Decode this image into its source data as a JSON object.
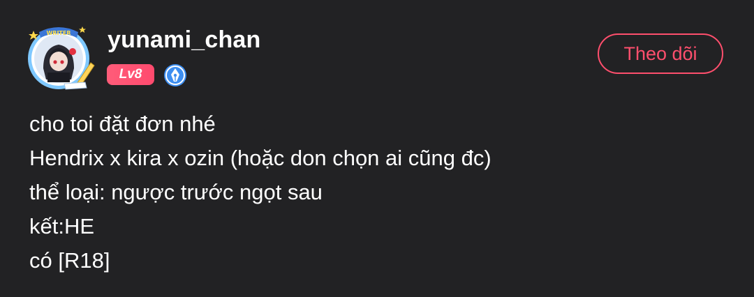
{
  "author": {
    "username": "yunami_chan",
    "avatar_frame_label": "WRITER",
    "level_badge": "Lv8",
    "writer_badge_icon": "pen-nib-icon"
  },
  "actions": {
    "follow_label": "Theo dõi"
  },
  "post": {
    "lines": [
      "cho toi đặt đơn nhé",
      "Hendrix x kira x ozin (hoặc don chọn ai cũng đc)",
      "thể loại: ngược trước ngọt sau",
      "kết:HE",
      "có [R18]"
    ]
  },
  "colors": {
    "background": "#222224",
    "accent": "#ff4f6d",
    "text": "#ffffff",
    "writer_badge": "#3d8ef0"
  }
}
